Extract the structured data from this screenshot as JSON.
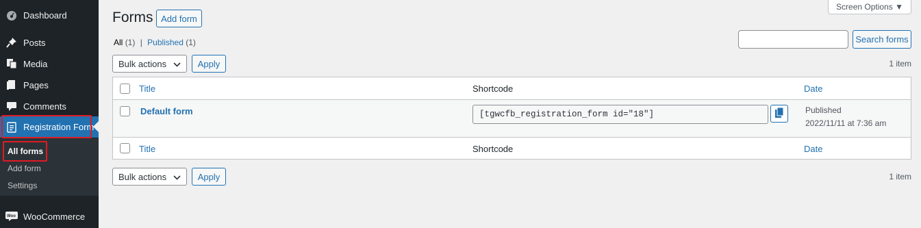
{
  "sidebar": {
    "items": [
      {
        "label": "Dashboard",
        "icon": "dashboard-icon"
      },
      {
        "label": "Posts",
        "icon": "pin-icon"
      },
      {
        "label": "Media",
        "icon": "media-icon"
      },
      {
        "label": "Pages",
        "icon": "pages-icon"
      },
      {
        "label": "Comments",
        "icon": "comment-icon"
      },
      {
        "label": "Registration Form",
        "icon": "form-icon"
      },
      {
        "label": "WooCommerce",
        "icon": "woocommerce-icon"
      }
    ],
    "submenu": [
      "All forms",
      "Add form",
      "Settings"
    ]
  },
  "header": {
    "title": "Forms",
    "add_button": "Add form",
    "screen_options": "Screen Options ▼"
  },
  "filters": {
    "all_label": "All",
    "all_count": "(1)",
    "separator": "|",
    "published_label": "Published",
    "published_count": "(1)"
  },
  "search": {
    "button": "Search forms",
    "value": ""
  },
  "bulk": {
    "select_label": "Bulk actions",
    "apply_label": "Apply"
  },
  "items_count": "1 item",
  "table": {
    "columns": {
      "title": "Title",
      "shortcode": "Shortcode",
      "date": "Date"
    },
    "rows": [
      {
        "title": "Default form",
        "shortcode": "[tgwcfb_registration_form id=\"18\"]",
        "status": "Published",
        "date": "2022/11/11 at 7:36 am"
      }
    ]
  },
  "colors": {
    "accent": "#2271b1",
    "sidebar_bg": "#1d2327",
    "highlight": "#e01b24"
  }
}
